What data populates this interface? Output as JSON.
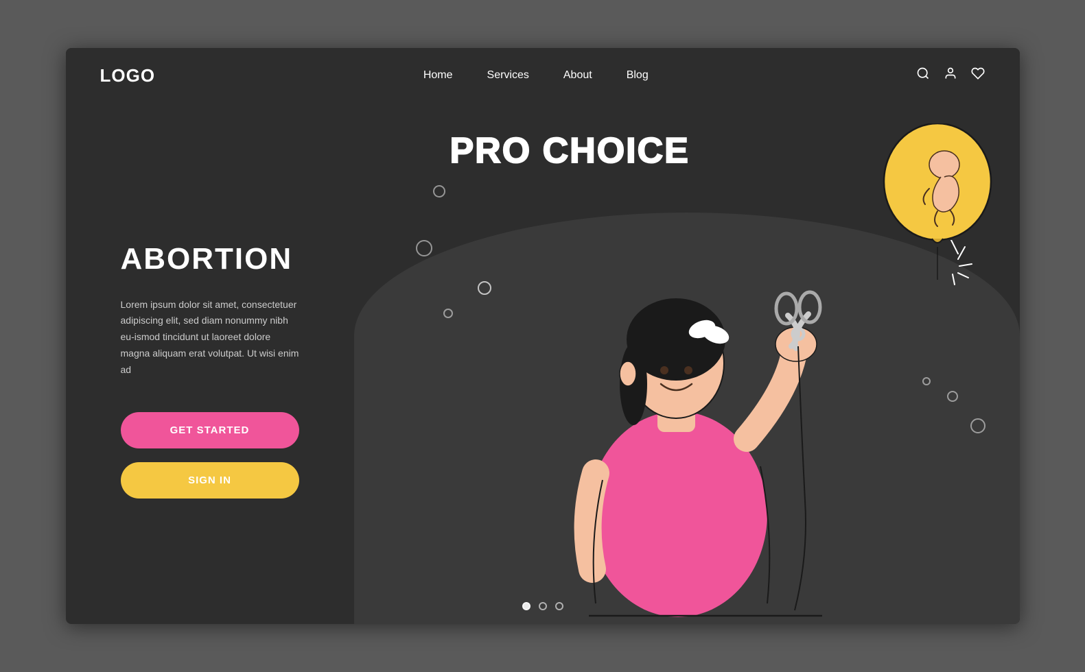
{
  "browser": {
    "background": "#5a5a5a",
    "window_bg": "#2d2d2d"
  },
  "navbar": {
    "logo": "LOGO",
    "links": [
      {
        "label": "Home",
        "id": "home"
      },
      {
        "label": "Services",
        "id": "services"
      },
      {
        "label": "About",
        "id": "about"
      },
      {
        "label": "Blog",
        "id": "blog"
      }
    ],
    "icons": [
      "search",
      "user",
      "heart"
    ]
  },
  "hero": {
    "title": "ABORTION",
    "pro_choice_label": "PRO CHOICE",
    "description": "Lorem ipsum dolor sit amet, consectetuer adipiscing elit, sed diam nonummy nibh eu-ismod tincidunt ut laoreet dolore magna aliquam erat volutpat. Ut wisi enim ad",
    "btn_primary": "GET STARTED",
    "btn_secondary": "SIGN IN"
  },
  "dots": [
    {
      "active": true
    },
    {
      "active": false
    },
    {
      "active": false
    }
  ]
}
